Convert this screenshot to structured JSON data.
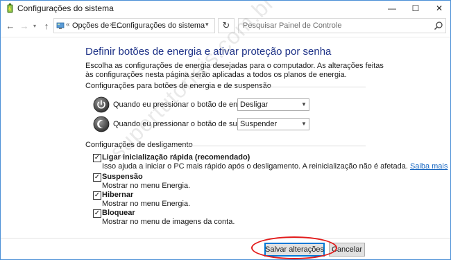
{
  "window": {
    "title": "Configurações do sistema",
    "controls": {
      "minimize": "—",
      "maximize": "☐",
      "close": "✕"
    }
  },
  "navigation": {
    "back_icon": "←",
    "forward_icon": "→",
    "recent_icon": "▾",
    "up_icon": "↑",
    "address": {
      "crumbs": [
        "Opções de E...",
        "Configurações do sistema"
      ],
      "separator": "›",
      "prefix": "«",
      "dropdown_icon": "▾"
    },
    "refresh_icon": "↻",
    "search": {
      "placeholder": "Pesquisar Painel de Controle",
      "value": ""
    }
  },
  "main": {
    "heading": "Definir botões de energia e ativar proteção por senha",
    "description": "Escolha as configurações de energia desejadas para o computador. As alterações feitas às configurações nesta página serão aplicadas a todos os planos de energia.",
    "power_section": {
      "title": "Configurações para botões de energia e de suspensão",
      "rows": [
        {
          "label": "Quando eu pressionar o botão de energia:",
          "value": "Desligar",
          "icon": "power-button-icon"
        },
        {
          "label": "Quando eu pressionar o botão de suspensão:",
          "value": "Suspender",
          "icon": "sleep-button-icon"
        }
      ]
    },
    "shutdown_section": {
      "title": "Configurações de desligamento",
      "options": [
        {
          "label": "Ligar inicialização rápida (recomendado)",
          "description": "Isso ajuda a iniciar o PC mais rápido após o desligamento. A reinicialização não é afetada.",
          "link": "Saiba mais",
          "checked": true
        },
        {
          "label": "Suspensão",
          "description": "Mostrar no menu Energia.",
          "checked": true
        },
        {
          "label": "Hibernar",
          "description": "Mostrar no menu Energia.",
          "checked": true
        },
        {
          "label": "Bloquear",
          "description": "Mostrar no menu de imagens da conta.",
          "checked": true
        }
      ]
    }
  },
  "watermark": "supertutoriais.com.br",
  "footer": {
    "save_label": "Salvar alterações",
    "cancel_label": "Cancelar"
  },
  "colors": {
    "heading": "#1e3287",
    "link": "#1565c0",
    "window_border": "#4a8fd6",
    "highlight": "#e31c1c"
  }
}
